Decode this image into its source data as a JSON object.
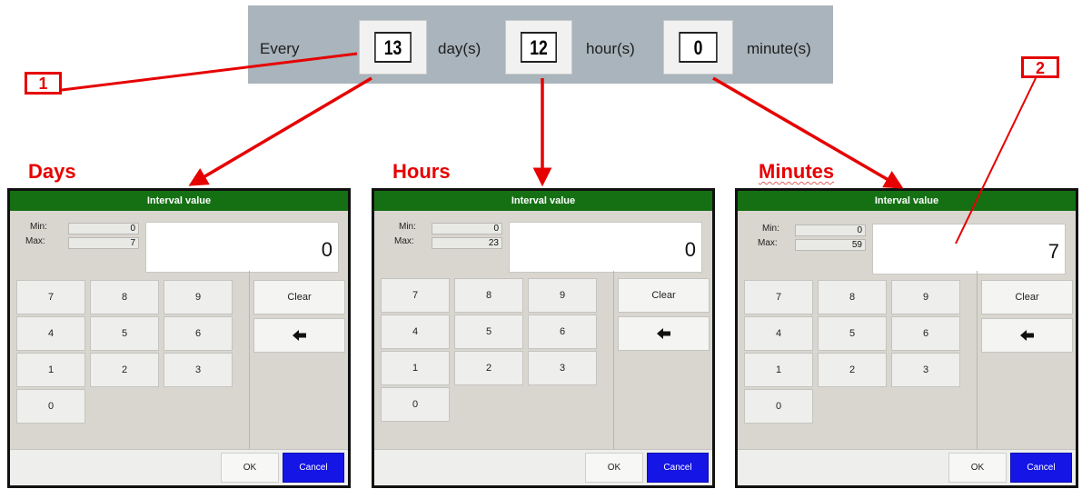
{
  "interval_bar": {
    "every_label": "Every",
    "days_value": "13",
    "days_unit": "day(s)",
    "hours_value": "12",
    "hours_unit": "hour(s)",
    "minutes_value": "0",
    "minutes_unit": "minute(s)"
  },
  "annotations": {
    "marker_1": "1",
    "marker_2": "2",
    "color": "#e60000"
  },
  "dialogs": {
    "days": {
      "heading": "Days",
      "title": "Interval value",
      "min_label": "Min:",
      "min_value": "0",
      "max_label": "Max:",
      "max_value": "7",
      "display_value": "0"
    },
    "hours": {
      "heading": "Hours",
      "title": "Interval value",
      "min_label": "Min:",
      "min_value": "0",
      "max_label": "Max:",
      "max_value": "23",
      "display_value": "0"
    },
    "minutes": {
      "heading": "Minutes",
      "title": "Interval value",
      "min_label": "Min:",
      "min_value": "0",
      "max_label": "Max:",
      "max_value": "59",
      "display_value": "7"
    }
  },
  "keypad": {
    "k7": "7",
    "k8": "8",
    "k9": "9",
    "k4": "4",
    "k5": "5",
    "k6": "6",
    "k1": "1",
    "k2": "2",
    "k3": "3",
    "k0": "0",
    "clear_label": "Clear",
    "backspace_icon": "arrow-left-icon",
    "ok_label": "OK",
    "cancel_label": "Cancel"
  },
  "colors": {
    "title_bar": "#157014",
    "cancel_button": "#1515e6",
    "interval_bar": "#a9b4bc"
  }
}
